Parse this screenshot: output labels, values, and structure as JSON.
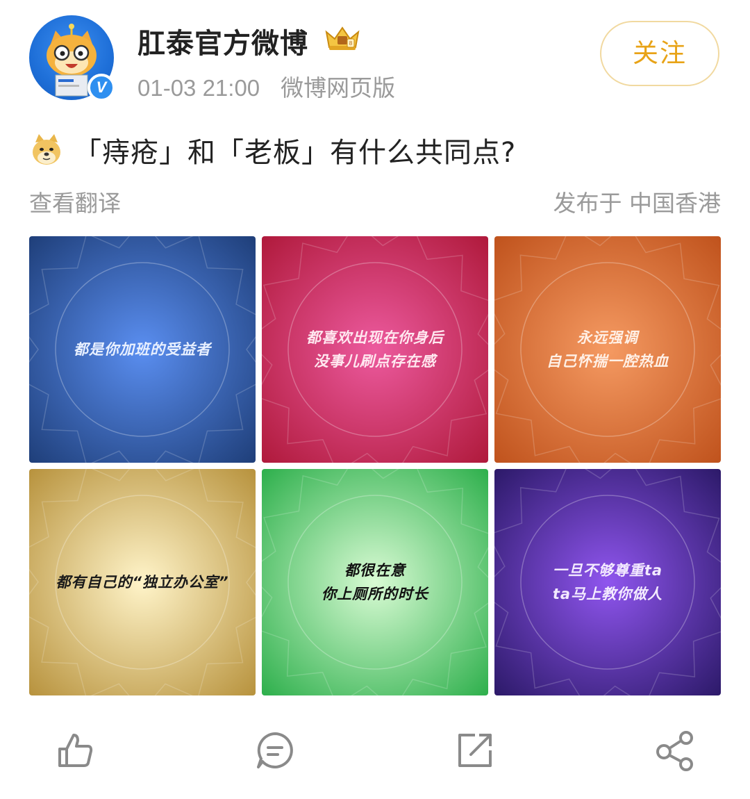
{
  "header": {
    "username": "肛泰官方微博",
    "time": "01-03 21:00",
    "source": "微博网页版",
    "follow_label": "关注",
    "badge_letter": "V",
    "avatar_icon": "cat-mascot-avatar",
    "crown_icon": "crown-badge-icon"
  },
  "post": {
    "text": "「痔疮」和「老板」有什么共同点?",
    "emoji_icon": "doge-emoji-icon",
    "translate_label": "查看翻译",
    "location": "发布于 中国香港"
  },
  "images": [
    {
      "lines": [
        "都是你加班的受益者"
      ],
      "color_center": "#5a8ef0",
      "color_edge": "#1f3f7a",
      "text_color": "#e8f0ff"
    },
    {
      "lines": [
        "都喜欢出现在你身后",
        "没事儿刷点存在感"
      ],
      "color_center": "#ec5a9e",
      "color_edge": "#b01a3c",
      "text_color": "#ffe8f0"
    },
    {
      "lines": [
        "永远强调",
        "自己怀揣一腔热血"
      ],
      "color_center": "#f59a62",
      "color_edge": "#c0531d",
      "text_color": "#fff0e6"
    },
    {
      "lines": [
        "都有自己的“独立办公室”"
      ],
      "color_center": "#fff4c9",
      "color_edge": "#b8933e",
      "text_color": "#1a1a1a"
    },
    {
      "lines": [
        "都很在意",
        "你上厕所的时长"
      ],
      "color_center": "#d9fbd4",
      "color_edge": "#2fb04d",
      "text_color": "#111111"
    },
    {
      "lines": [
        "一旦不够尊重ta",
        "ta马上教你做人"
      ],
      "color_center": "#8f55ee",
      "color_edge": "#2d1a6a",
      "text_color": "#f3eaff"
    }
  ],
  "actions": [
    {
      "name": "like-icon"
    },
    {
      "name": "comment-icon"
    },
    {
      "name": "repost-icon"
    },
    {
      "name": "share-icon"
    }
  ]
}
